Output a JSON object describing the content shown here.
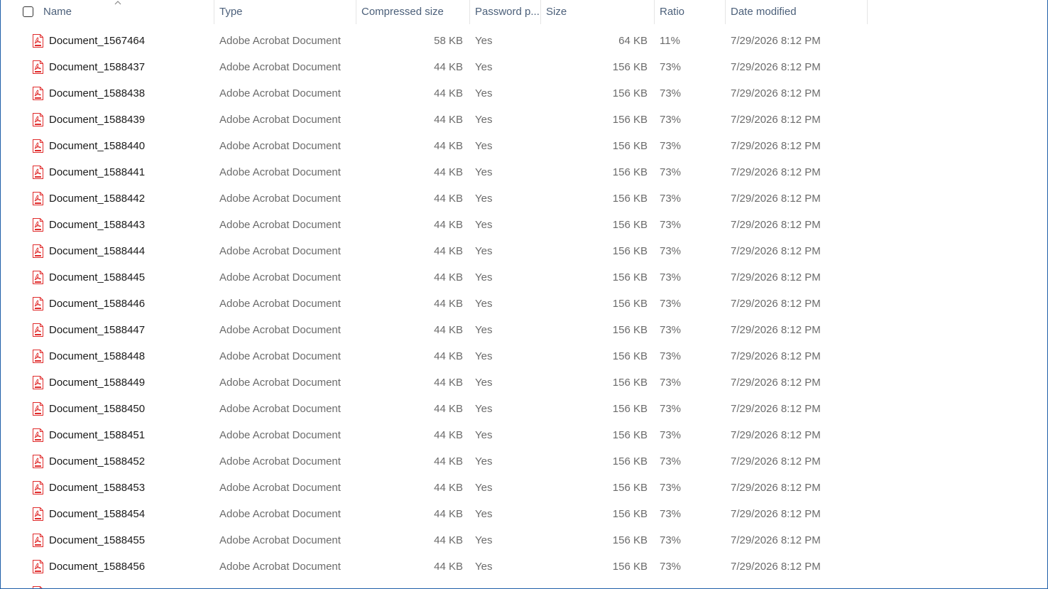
{
  "columns": {
    "name": "Name",
    "type": "Type",
    "compressed_size": "Compressed size",
    "password": "Password p...",
    "size": "Size",
    "ratio": "Ratio",
    "date_modified": "Date modified"
  },
  "icons": {
    "file": "pdf-file-icon",
    "sort": "sort-ascending-caret-icon",
    "accent": "#e02b2b"
  },
  "files": [
    {
      "name": "Document_1567464",
      "type": "Adobe Acrobat Document",
      "compressed": "58 KB",
      "password": "Yes",
      "size": "64 KB",
      "ratio": "11%",
      "date": "7/29/2026 8:12 PM"
    },
    {
      "name": "Document_1588437",
      "type": "Adobe Acrobat Document",
      "compressed": "44 KB",
      "password": "Yes",
      "size": "156 KB",
      "ratio": "73%",
      "date": "7/29/2026 8:12 PM"
    },
    {
      "name": "Document_1588438",
      "type": "Adobe Acrobat Document",
      "compressed": "44 KB",
      "password": "Yes",
      "size": "156 KB",
      "ratio": "73%",
      "date": "7/29/2026 8:12 PM"
    },
    {
      "name": "Document_1588439",
      "type": "Adobe Acrobat Document",
      "compressed": "44 KB",
      "password": "Yes",
      "size": "156 KB",
      "ratio": "73%",
      "date": "7/29/2026 8:12 PM"
    },
    {
      "name": "Document_1588440",
      "type": "Adobe Acrobat Document",
      "compressed": "44 KB",
      "password": "Yes",
      "size": "156 KB",
      "ratio": "73%",
      "date": "7/29/2026 8:12 PM"
    },
    {
      "name": "Document_1588441",
      "type": "Adobe Acrobat Document",
      "compressed": "44 KB",
      "password": "Yes",
      "size": "156 KB",
      "ratio": "73%",
      "date": "7/29/2026 8:12 PM"
    },
    {
      "name": "Document_1588442",
      "type": "Adobe Acrobat Document",
      "compressed": "44 KB",
      "password": "Yes",
      "size": "156 KB",
      "ratio": "73%",
      "date": "7/29/2026 8:12 PM"
    },
    {
      "name": "Document_1588443",
      "type": "Adobe Acrobat Document",
      "compressed": "44 KB",
      "password": "Yes",
      "size": "156 KB",
      "ratio": "73%",
      "date": "7/29/2026 8:12 PM"
    },
    {
      "name": "Document_1588444",
      "type": "Adobe Acrobat Document",
      "compressed": "44 KB",
      "password": "Yes",
      "size": "156 KB",
      "ratio": "73%",
      "date": "7/29/2026 8:12 PM"
    },
    {
      "name": "Document_1588445",
      "type": "Adobe Acrobat Document",
      "compressed": "44 KB",
      "password": "Yes",
      "size": "156 KB",
      "ratio": "73%",
      "date": "7/29/2026 8:12 PM"
    },
    {
      "name": "Document_1588446",
      "type": "Adobe Acrobat Document",
      "compressed": "44 KB",
      "password": "Yes",
      "size": "156 KB",
      "ratio": "73%",
      "date": "7/29/2026 8:12 PM"
    },
    {
      "name": "Document_1588447",
      "type": "Adobe Acrobat Document",
      "compressed": "44 KB",
      "password": "Yes",
      "size": "156 KB",
      "ratio": "73%",
      "date": "7/29/2026 8:12 PM"
    },
    {
      "name": "Document_1588448",
      "type": "Adobe Acrobat Document",
      "compressed": "44 KB",
      "password": "Yes",
      "size": "156 KB",
      "ratio": "73%",
      "date": "7/29/2026 8:12 PM"
    },
    {
      "name": "Document_1588449",
      "type": "Adobe Acrobat Document",
      "compressed": "44 KB",
      "password": "Yes",
      "size": "156 KB",
      "ratio": "73%",
      "date": "7/29/2026 8:12 PM"
    },
    {
      "name": "Document_1588450",
      "type": "Adobe Acrobat Document",
      "compressed": "44 KB",
      "password": "Yes",
      "size": "156 KB",
      "ratio": "73%",
      "date": "7/29/2026 8:12 PM"
    },
    {
      "name": "Document_1588451",
      "type": "Adobe Acrobat Document",
      "compressed": "44 KB",
      "password": "Yes",
      "size": "156 KB",
      "ratio": "73%",
      "date": "7/29/2026 8:12 PM"
    },
    {
      "name": "Document_1588452",
      "type": "Adobe Acrobat Document",
      "compressed": "44 KB",
      "password": "Yes",
      "size": "156 KB",
      "ratio": "73%",
      "date": "7/29/2026 8:12 PM"
    },
    {
      "name": "Document_1588453",
      "type": "Adobe Acrobat Document",
      "compressed": "44 KB",
      "password": "Yes",
      "size": "156 KB",
      "ratio": "73%",
      "date": "7/29/2026 8:12 PM"
    },
    {
      "name": "Document_1588454",
      "type": "Adobe Acrobat Document",
      "compressed": "44 KB",
      "password": "Yes",
      "size": "156 KB",
      "ratio": "73%",
      "date": "7/29/2026 8:12 PM"
    },
    {
      "name": "Document_1588455",
      "type": "Adobe Acrobat Document",
      "compressed": "44 KB",
      "password": "Yes",
      "size": "156 KB",
      "ratio": "73%",
      "date": "7/29/2026 8:12 PM"
    },
    {
      "name": "Document_1588456",
      "type": "Adobe Acrobat Document",
      "compressed": "44 KB",
      "password": "Yes",
      "size": "156 KB",
      "ratio": "73%",
      "date": "7/29/2026 8:12 PM"
    },
    {
      "name": "",
      "type": "",
      "compressed": "",
      "password": "",
      "size": "",
      "ratio": "",
      "date": ""
    }
  ]
}
